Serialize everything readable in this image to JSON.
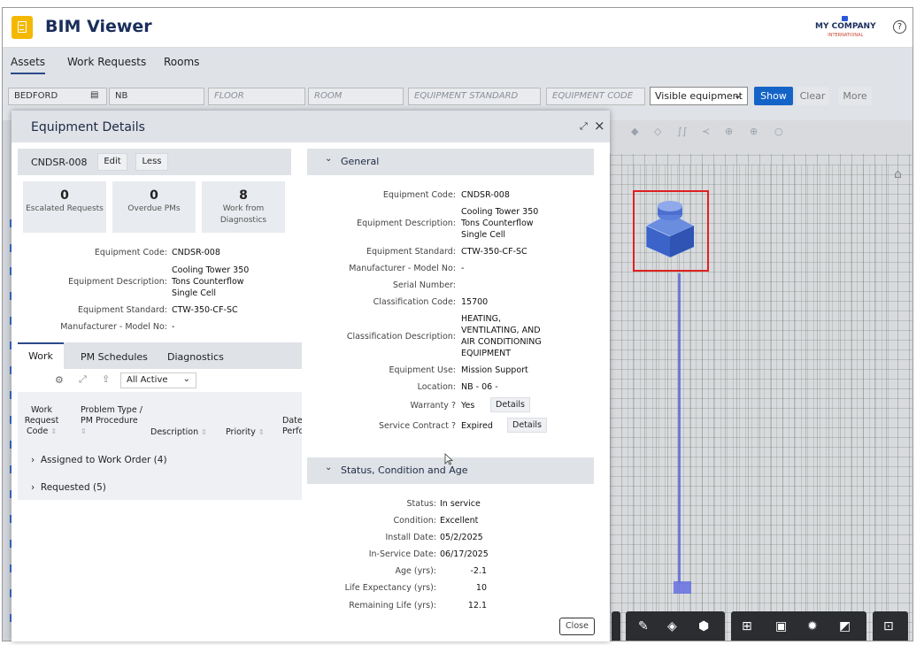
{
  "app": {
    "title": "BIM Viewer",
    "company": "MY COMPANY",
    "company_sub": "INTERNATIONAL",
    "help": "?"
  },
  "tabs": [
    "Assets",
    "Work Requests",
    "Rooms"
  ],
  "filters": {
    "site": "BEDFORD",
    "building": "NB",
    "floor_placeholder": "FLOOR",
    "room_placeholder": "ROOM",
    "equipment_standard_placeholder": "EQUIPMENT STANDARD",
    "equipment_code_placeholder": "EQUIPMENT CODE",
    "visibility": "Visible equipment",
    "show": "Show",
    "clear": "Clear",
    "more": "More"
  },
  "modal": {
    "title": "Equipment Details",
    "close": "Close"
  },
  "left": {
    "equipment_id": "CNDSR-008",
    "edit": "Edit",
    "less": "Less",
    "stats": [
      {
        "value": "0",
        "label": "Escalated Requests"
      },
      {
        "value": "0",
        "label": "Overdue PMs"
      },
      {
        "value": "8",
        "label": "Work from Diagnostics"
      }
    ],
    "fields": [
      {
        "k": "Equipment Code:",
        "v": "CNDSR-008"
      },
      {
        "k": "Equipment Description:",
        "v": "Cooling Tower 350 Tons Counterflow Single Cell"
      },
      {
        "k": "Equipment Standard:",
        "v": "CTW-350-CF-SC"
      },
      {
        "k": "Manufacturer - Model No:",
        "v": "-"
      }
    ],
    "work_tabs": [
      "Work",
      "PM Schedules",
      "Diagnostics"
    ],
    "filter_select": "All Active",
    "columns": [
      "Work Request Code",
      "Problem Type / PM Procedure",
      "Description",
      "Priority",
      "Date Perfo"
    ],
    "groups": [
      "Assigned to Work Order (4)",
      "Requested (5)"
    ]
  },
  "general": {
    "heading": "General",
    "fields": [
      {
        "k": "Equipment Code:",
        "v": "CNDSR-008"
      },
      {
        "k": "Equipment Description:",
        "v": "Cooling Tower 350 Tons Counterflow Single Cell"
      },
      {
        "k": "Equipment Standard:",
        "v": "CTW-350-CF-SC"
      },
      {
        "k": "Manufacturer - Model No:",
        "v": "-"
      },
      {
        "k": "Serial Number:",
        "v": ""
      },
      {
        "k": "Classification Code:",
        "v": "15700"
      },
      {
        "k": "Classification Description:",
        "v": "HEATING, VENTILATING, AND AIR CONDITIONING EQUIPMENT"
      },
      {
        "k": "Equipment Use:",
        "v": "Mission Support"
      },
      {
        "k": "Location:",
        "v": "NB - 06 -"
      },
      {
        "k": "Warranty ?",
        "v": "Yes"
      },
      {
        "k": "Service Contract ?",
        "v": "Expired"
      }
    ],
    "details": "Details"
  },
  "status": {
    "heading": "Status, Condition and Age",
    "fields": [
      {
        "k": "Status:",
        "v": "In service"
      },
      {
        "k": "Condition:",
        "v": "Excellent"
      },
      {
        "k": "Install Date:",
        "v": "05/2/2025"
      },
      {
        "k": "In-Service Date:",
        "v": "06/17/2025"
      },
      {
        "k": "Age (yrs):",
        "v": "-2.1"
      },
      {
        "k": "Life Expectancy (yrs):",
        "v": "10"
      },
      {
        "k": "Remaining Life (yrs):",
        "v": "12.1"
      }
    ]
  },
  "icons": [
    "gear-icon",
    "expand-icon",
    "export-icon",
    "home-icon",
    "ruler-icon",
    "cube-up-icon",
    "cube-icon",
    "hierarchy-icon",
    "panel-icon",
    "settings-icon",
    "fullscreen-icon",
    "screen-icon"
  ]
}
